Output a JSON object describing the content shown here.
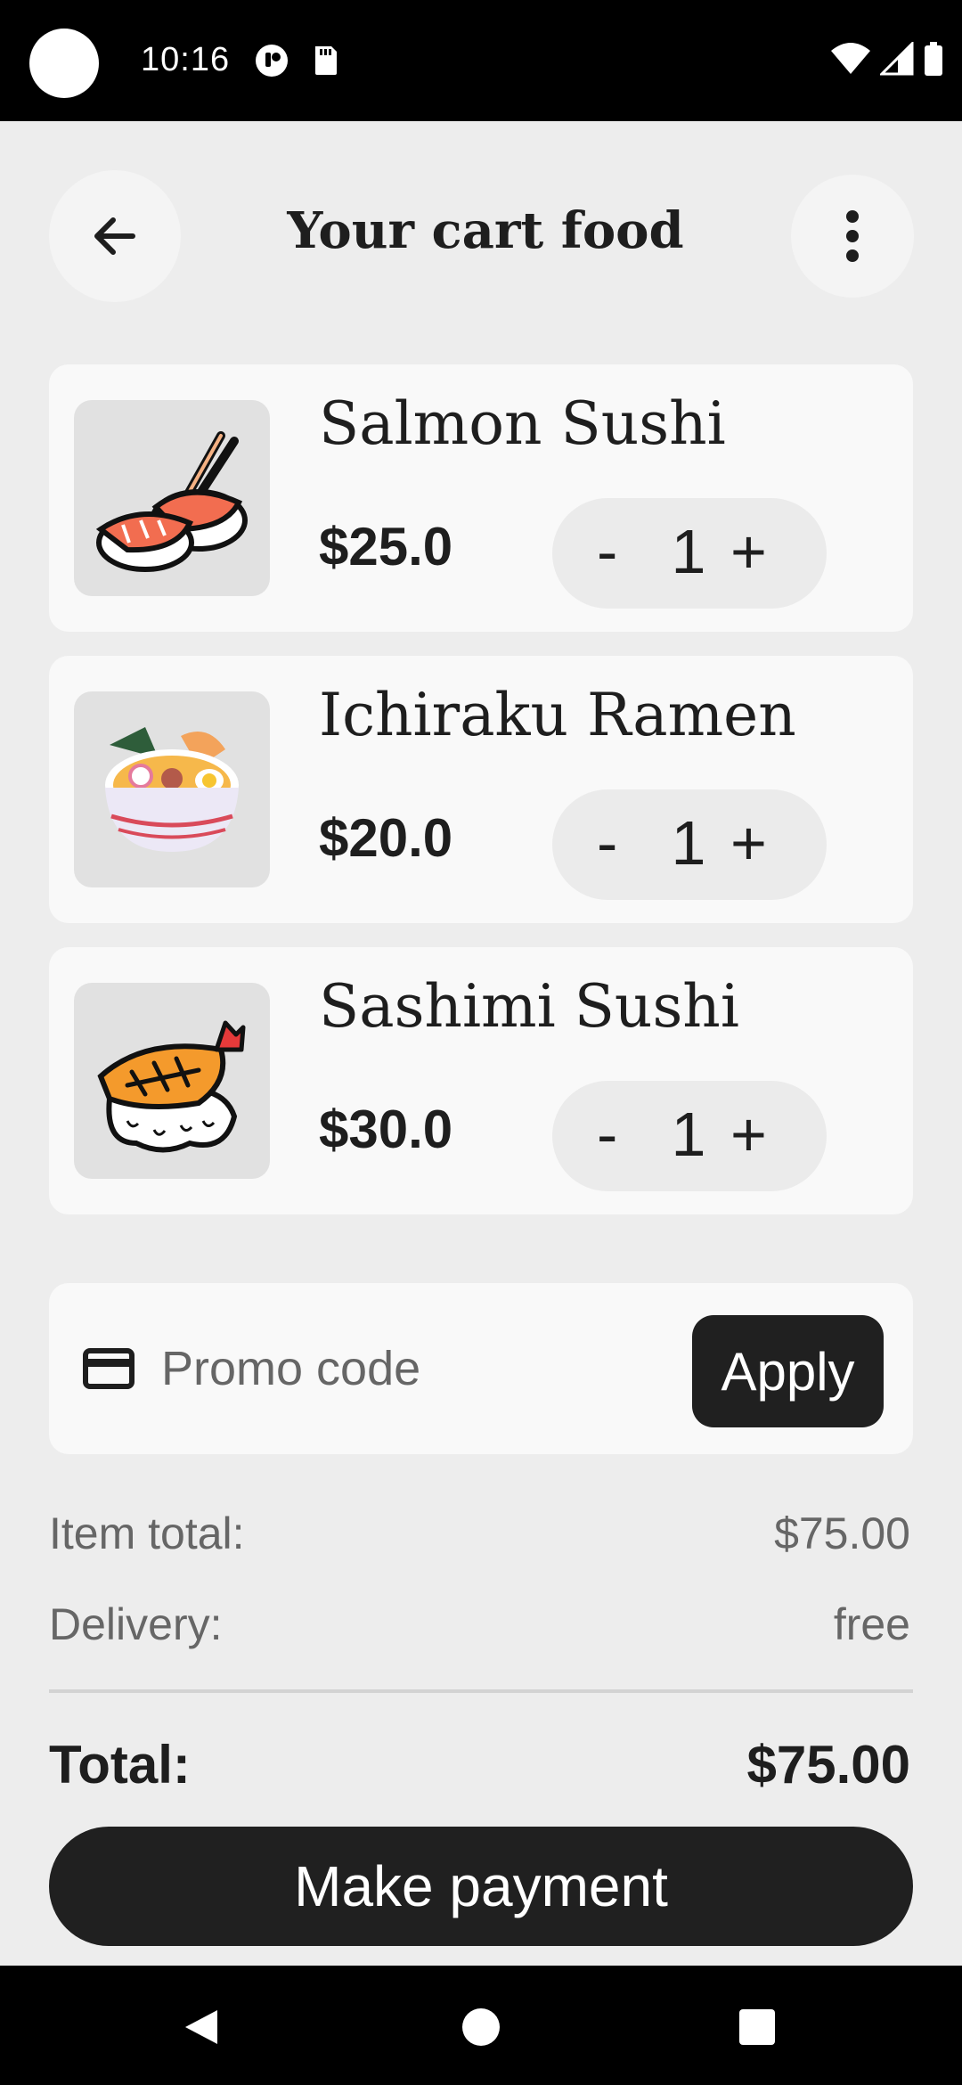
{
  "status_bar": {
    "time": "10:16"
  },
  "header": {
    "title": "Your cart food"
  },
  "cart_items": [
    {
      "name": "Salmon Sushi",
      "price": "$25.0",
      "quantity": "1",
      "image_icon": "salmon-sushi-icon"
    },
    {
      "name": "Ichiraku Ramen",
      "price": "$20.0",
      "quantity": "1",
      "image_icon": "ramen-bowl-icon"
    },
    {
      "name": "Sashimi Sushi",
      "price": "$30.0",
      "quantity": "1",
      "image_icon": "shrimp-sushi-icon"
    }
  ],
  "stepper": {
    "minus": "-",
    "plus": "+"
  },
  "promo": {
    "placeholder": "Promo code",
    "value": "",
    "apply_label": "Apply"
  },
  "summary": {
    "item_total_label": "Item total:",
    "item_total_value": "$75.00",
    "delivery_label": "Delivery:",
    "delivery_value": "free",
    "total_label": "Total:",
    "total_value": "$75.00"
  },
  "actions": {
    "pay_label": "Make payment"
  },
  "colors": {
    "background": "#ededed",
    "card": "#f9f9f9",
    "primary_button": "#202020",
    "text": "#1e1e1e",
    "muted_text": "#666666"
  }
}
